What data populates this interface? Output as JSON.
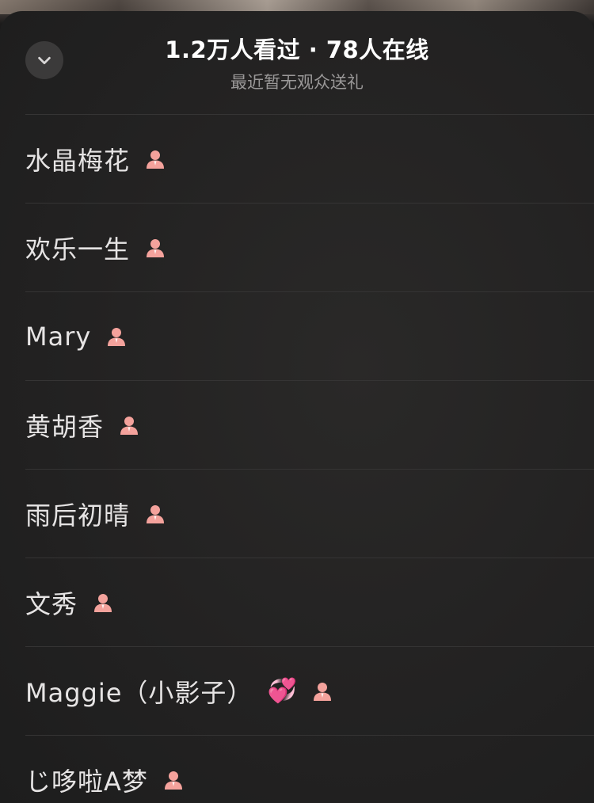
{
  "header": {
    "title": "1.2万人看过 · 78人在线",
    "subtitle": "最近暂无观众送礼"
  },
  "viewers": [
    {
      "name": "水晶梅花",
      "badges": [
        "person-icon"
      ]
    },
    {
      "name": "欢乐一生",
      "badges": [
        "person-icon"
      ]
    },
    {
      "name": "Mary",
      "badges": [
        "person-icon"
      ]
    },
    {
      "name": "黄胡香",
      "badges": [
        "person-icon"
      ]
    },
    {
      "name": "雨后初晴",
      "badges": [
        "person-icon"
      ]
    },
    {
      "name": "文秀",
      "badges": [
        "person-icon"
      ]
    },
    {
      "name": "Maggie（小影子）",
      "emoji": "💞",
      "badges": [
        "person-icon"
      ]
    },
    {
      "name": "じ哆啦A梦",
      "badges": [
        "person-icon"
      ]
    }
  ],
  "colors": {
    "sheet_background": "#232222",
    "person_icon": "#f4a29c",
    "heart_emoji": "#ff4fa8"
  }
}
